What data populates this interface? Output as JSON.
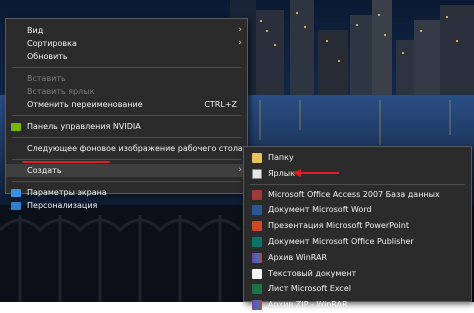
{
  "context_menu": {
    "items": [
      {
        "label": "Вид",
        "has_submenu": true
      },
      {
        "label": "Сортировка",
        "has_submenu": true
      },
      {
        "label": "Обновить"
      },
      {
        "label": "Вставить",
        "disabled": true
      },
      {
        "label": "Вставить ярлык",
        "disabled": true
      },
      {
        "label": "Отменить переименование",
        "shortcut": "CTRL+Z"
      },
      {
        "label": "Панель управления NVIDIA",
        "icon": "nvidia-icon"
      },
      {
        "label": "Следующее фоновое изображение рабочего стола"
      },
      {
        "label": "Создать",
        "has_submenu": true
      },
      {
        "label": "Параметры экрана",
        "icon": "display-icon"
      },
      {
        "label": "Персонализация",
        "icon": "personalization-icon"
      }
    ]
  },
  "submenu_create": {
    "items": [
      {
        "label": "Папку",
        "icon": "folder-icon"
      },
      {
        "label": "Ярлык",
        "icon": "shortcut-icon"
      },
      {
        "label": "Microsoft Office Access 2007 База данных",
        "icon": "access-icon"
      },
      {
        "label": "Документ Microsoft Word",
        "icon": "word-icon"
      },
      {
        "label": "Презентация Microsoft PowerPoint",
        "icon": "powerpoint-icon"
      },
      {
        "label": "Документ Microsoft Office Publisher",
        "icon": "publisher-icon"
      },
      {
        "label": "Архив WinRAR",
        "icon": "winrar-icon"
      },
      {
        "label": "Текстовый документ",
        "icon": "text-document-icon"
      },
      {
        "label": "Лист Microsoft Excel",
        "icon": "excel-icon"
      },
      {
        "label": "Архив ZIP - WinRAR",
        "icon": "zip-icon"
      }
    ]
  },
  "colors": {
    "menu_bg": "#2b2b2b",
    "annotation_red": "#d91f1f",
    "nvidia_green": "#76b900"
  }
}
